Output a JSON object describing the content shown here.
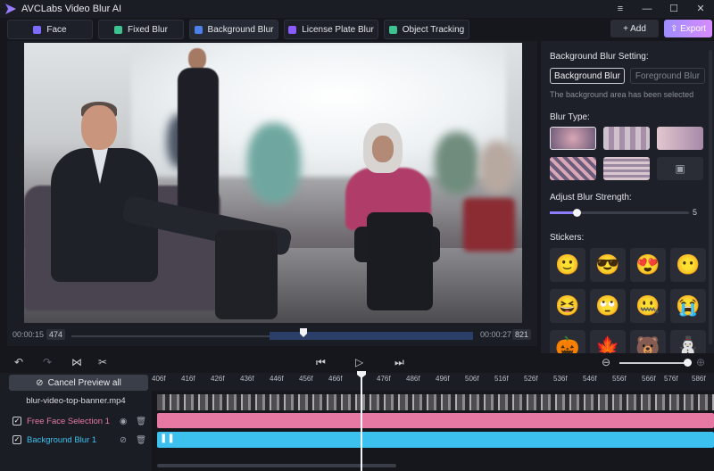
{
  "app": {
    "title": "AVCLabs Video Blur AI"
  },
  "window_controls": {
    "menu": "≡",
    "minimize": "—",
    "maximize": "☐",
    "close": "✕"
  },
  "modes": [
    {
      "label": "Face",
      "color": "#7b6bff"
    },
    {
      "label": "Fixed Blur",
      "color": "#3ec28f"
    },
    {
      "label": "Background Blur",
      "color": "#4d7fe8"
    },
    {
      "label": "License Plate Blur",
      "color": "#8a5cff"
    },
    {
      "label": "Object Tracking",
      "color": "#3ec28f"
    }
  ],
  "actions": {
    "add": "+ Add",
    "export": "⇪ Export"
  },
  "preview": {
    "start_time": "00:00:15",
    "start_frame": "474",
    "end_time": "00:00:27",
    "end_frame": "821"
  },
  "side": {
    "setting_title": "Background Blur Setting:",
    "bg_button": "Background Blur",
    "fg_button": "Foreground Blur",
    "note": "The background area has been selected",
    "blur_type_title": "Blur Type:",
    "strength_title": "Adjust Blur Strength:",
    "strength_value": "5",
    "stickers_title": "Stickers:",
    "stickers": [
      "🙂",
      "😎",
      "😍",
      "😶",
      "😆",
      "🙄",
      "🤐",
      "😭",
      "🎃",
      "🍁",
      "🐻",
      "⛄"
    ]
  },
  "timeline": {
    "cancel_preview": "Cancel Preview all",
    "clip_name": "blur-video-top-banner.mp4",
    "tracks": [
      {
        "label": "Free Face Selection 1",
        "color": "#e579a3"
      },
      {
        "label": "Background Blur 1",
        "color": "#3cc1ef"
      }
    ],
    "ruler": [
      "406f",
      "416f",
      "426f",
      "436f",
      "446f",
      "456f",
      "466f",
      "476f",
      "486f",
      "496f",
      "506f",
      "516f",
      "526f",
      "536f",
      "546f",
      "556f",
      "566f",
      "576f",
      "586f"
    ]
  }
}
